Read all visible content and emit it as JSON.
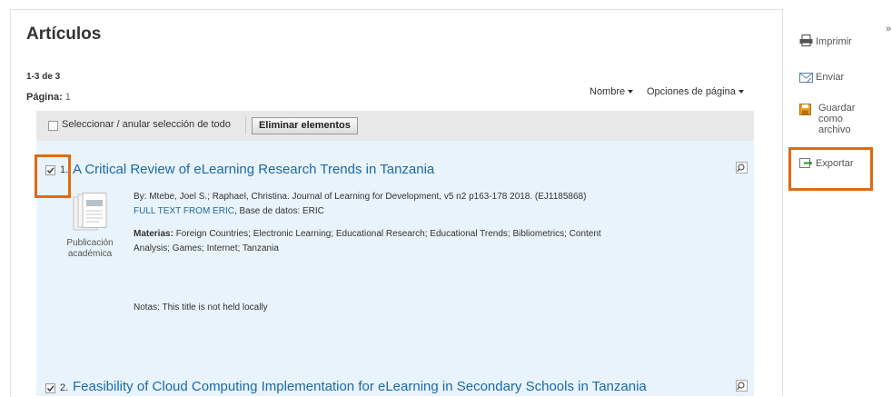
{
  "header": {
    "title": "Artículos",
    "collapse_glyph": "»"
  },
  "meta": {
    "count": "1-3 de 3",
    "page_label": "Página:",
    "page_value": "1"
  },
  "sort": {
    "label": "Nombre",
    "page_options": "Opciones de página"
  },
  "toolbar": {
    "select_all_label": "Seleccionar / anular selección de todo",
    "remove_button": "Eliminar elementos"
  },
  "results": [
    {
      "number": "1.",
      "title": "A Critical Review of eLearning Research Trends in Tanzania",
      "checked": true,
      "byline": "By: Mtebe, Joel S.; Raphael, Christina. Journal of Learning for Development, v5 n2 p163-178 2018. (EJ1185868)",
      "fulltext": "FULL TEXT FROM ERIC",
      "database": ", Base de datos: ERIC",
      "subjects_label": "Materias:",
      "subjects_1": "Foreign Countries; Electronic Learning; Educational Research; Educational Trends; Bibliometrics; Content",
      "subjects_2": "Analysis; Games; Internet; Tanzania",
      "pubtype_1": "Publicación",
      "pubtype_2": "académica",
      "notes": "Notas:  This title is not held locally"
    },
    {
      "number": "2.",
      "title": "Feasibility of Cloud Computing Implementation for eLearning in Secondary Schools in Tanzania",
      "checked": true
    }
  ],
  "sidebar": {
    "print": "Imprimir",
    "email": "Enviar",
    "save_1": "Guardar",
    "save_2": "como",
    "save_3": "archivo",
    "export": "Exportar"
  },
  "colors": {
    "link": "#1a6aa8",
    "highlight": "#e06a10",
    "result_bg": "#e9f3fb"
  }
}
